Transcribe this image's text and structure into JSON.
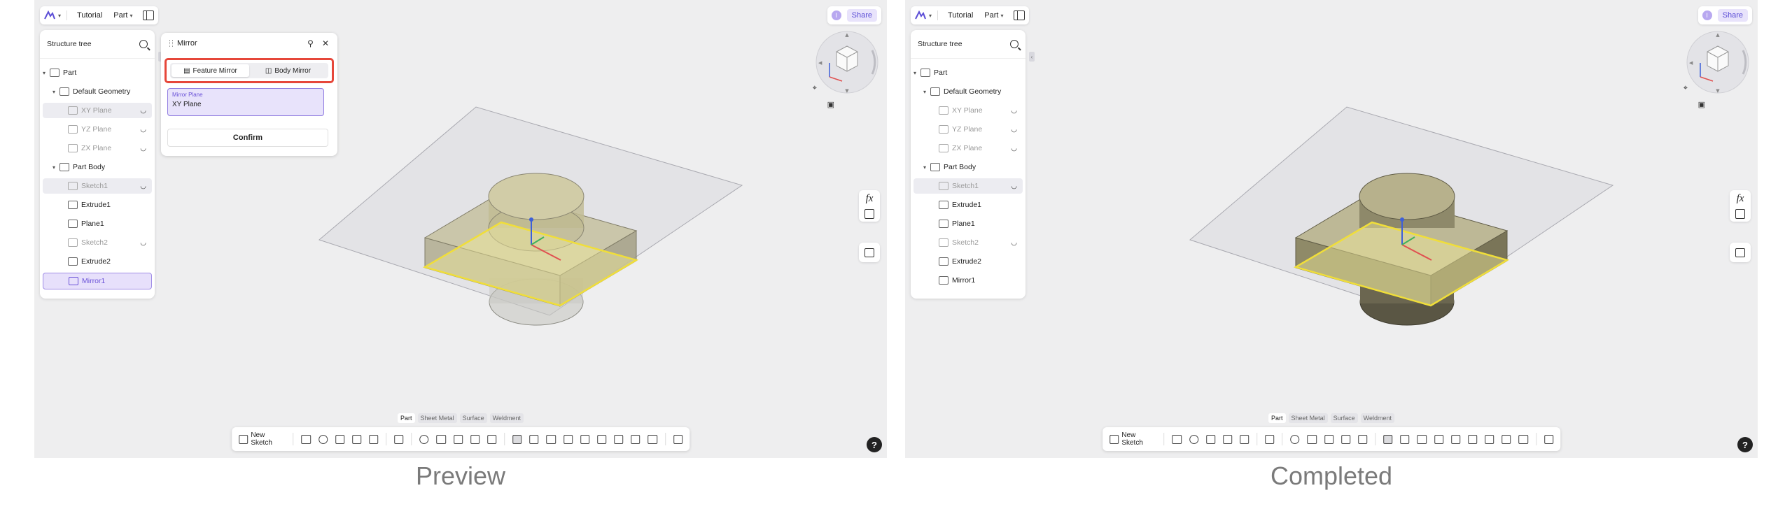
{
  "captions": {
    "left": "Preview",
    "right": "Completed"
  },
  "topbar": {
    "tutorial": "Tutorial",
    "part": "Part",
    "share": "Share",
    "avatar": "I"
  },
  "tree": {
    "title": "Structure tree",
    "items": [
      {
        "label": "Part"
      },
      {
        "label": "Default Geometry"
      },
      {
        "label": "XY Plane"
      },
      {
        "label": "YZ Plane"
      },
      {
        "label": "ZX Plane"
      },
      {
        "label": "Part Body"
      },
      {
        "label": "Sketch1"
      },
      {
        "label": "Extrude1"
      },
      {
        "label": "Plane1"
      },
      {
        "label": "Sketch2"
      },
      {
        "label": "Extrude2"
      },
      {
        "label": "Mirror1"
      }
    ]
  },
  "mirror_panel": {
    "title": "Mirror",
    "feature_mirror": "Feature Mirror",
    "body_mirror": "Body Mirror",
    "plane_label": "Mirror Plane",
    "plane_value": "XY Plane",
    "confirm": "Confirm"
  },
  "tabs": [
    "Part",
    "Sheet Metal",
    "Surface",
    "Weldment"
  ],
  "toolbar": {
    "new_sketch": "New Sketch"
  },
  "right_tools": {
    "fx": "fx"
  },
  "help": "?",
  "colors": {
    "accent": "#5b4dd6",
    "highlight": "#e6473a",
    "selection": "#e7e0fb",
    "sketch_line": "#f0de3a",
    "body": "#b9b48e"
  }
}
